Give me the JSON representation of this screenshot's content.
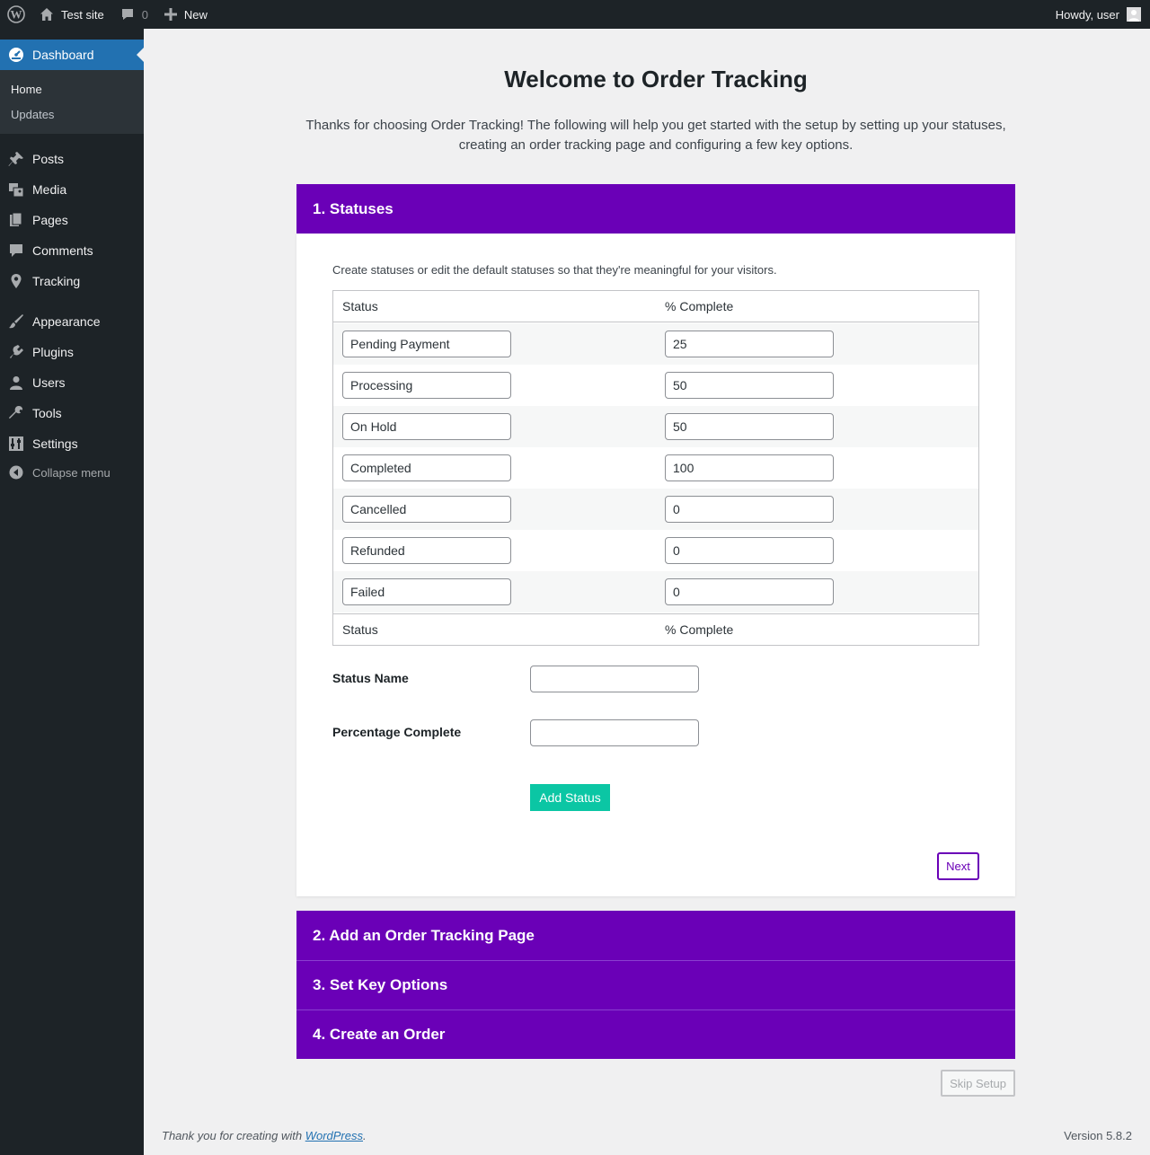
{
  "adminbar": {
    "site_name": "Test site",
    "comments_count": "0",
    "new_label": "New",
    "howdy": "Howdy, user"
  },
  "sidebar": {
    "dashboard": "Dashboard",
    "submenu": [
      "Home",
      "Updates"
    ],
    "items": [
      "Posts",
      "Media",
      "Pages",
      "Comments",
      "Tracking",
      "Appearance",
      "Plugins",
      "Users",
      "Tools",
      "Settings"
    ],
    "collapse": "Collapse menu"
  },
  "main": {
    "title": "Welcome to Order Tracking",
    "intro": "Thanks for choosing Order Tracking! The following will help you get started with the setup by setting up your statuses, creating an order tracking page and configuring a few key options.",
    "steps": [
      "1. Statuses",
      "2. Add an Order Tracking Page",
      "3. Set Key Options",
      "4. Create an Order"
    ],
    "panel_desc": "Create statuses or edit the default statuses so that they're meaningful for your visitors.",
    "table": {
      "col_status": "Status",
      "col_percent": "% Complete",
      "rows": [
        {
          "status": "Pending Payment",
          "percent": "25"
        },
        {
          "status": "Processing",
          "percent": "50"
        },
        {
          "status": "On Hold",
          "percent": "50"
        },
        {
          "status": "Completed",
          "percent": "100"
        },
        {
          "status": "Cancelled",
          "percent": "0"
        },
        {
          "status": "Refunded",
          "percent": "0"
        },
        {
          "status": "Failed",
          "percent": "0"
        }
      ]
    },
    "status_name_label": "Status Name",
    "status_name_value": "",
    "percentage_label": "Percentage Complete",
    "percentage_value": "",
    "add_button": "Add Status",
    "next_button": "Next",
    "skip_button": "Skip Setup"
  },
  "footer": {
    "thanks_prefix": "Thank you for creating with ",
    "thanks_link": "WordPress",
    "thanks_suffix": ".",
    "version": "Version 5.8.2"
  },
  "colors": {
    "accent_purple": "#6a00b7",
    "add_button_teal": "#0bc6a4",
    "admin_dark": "#1d2327",
    "wp_blue": "#2271b1"
  }
}
